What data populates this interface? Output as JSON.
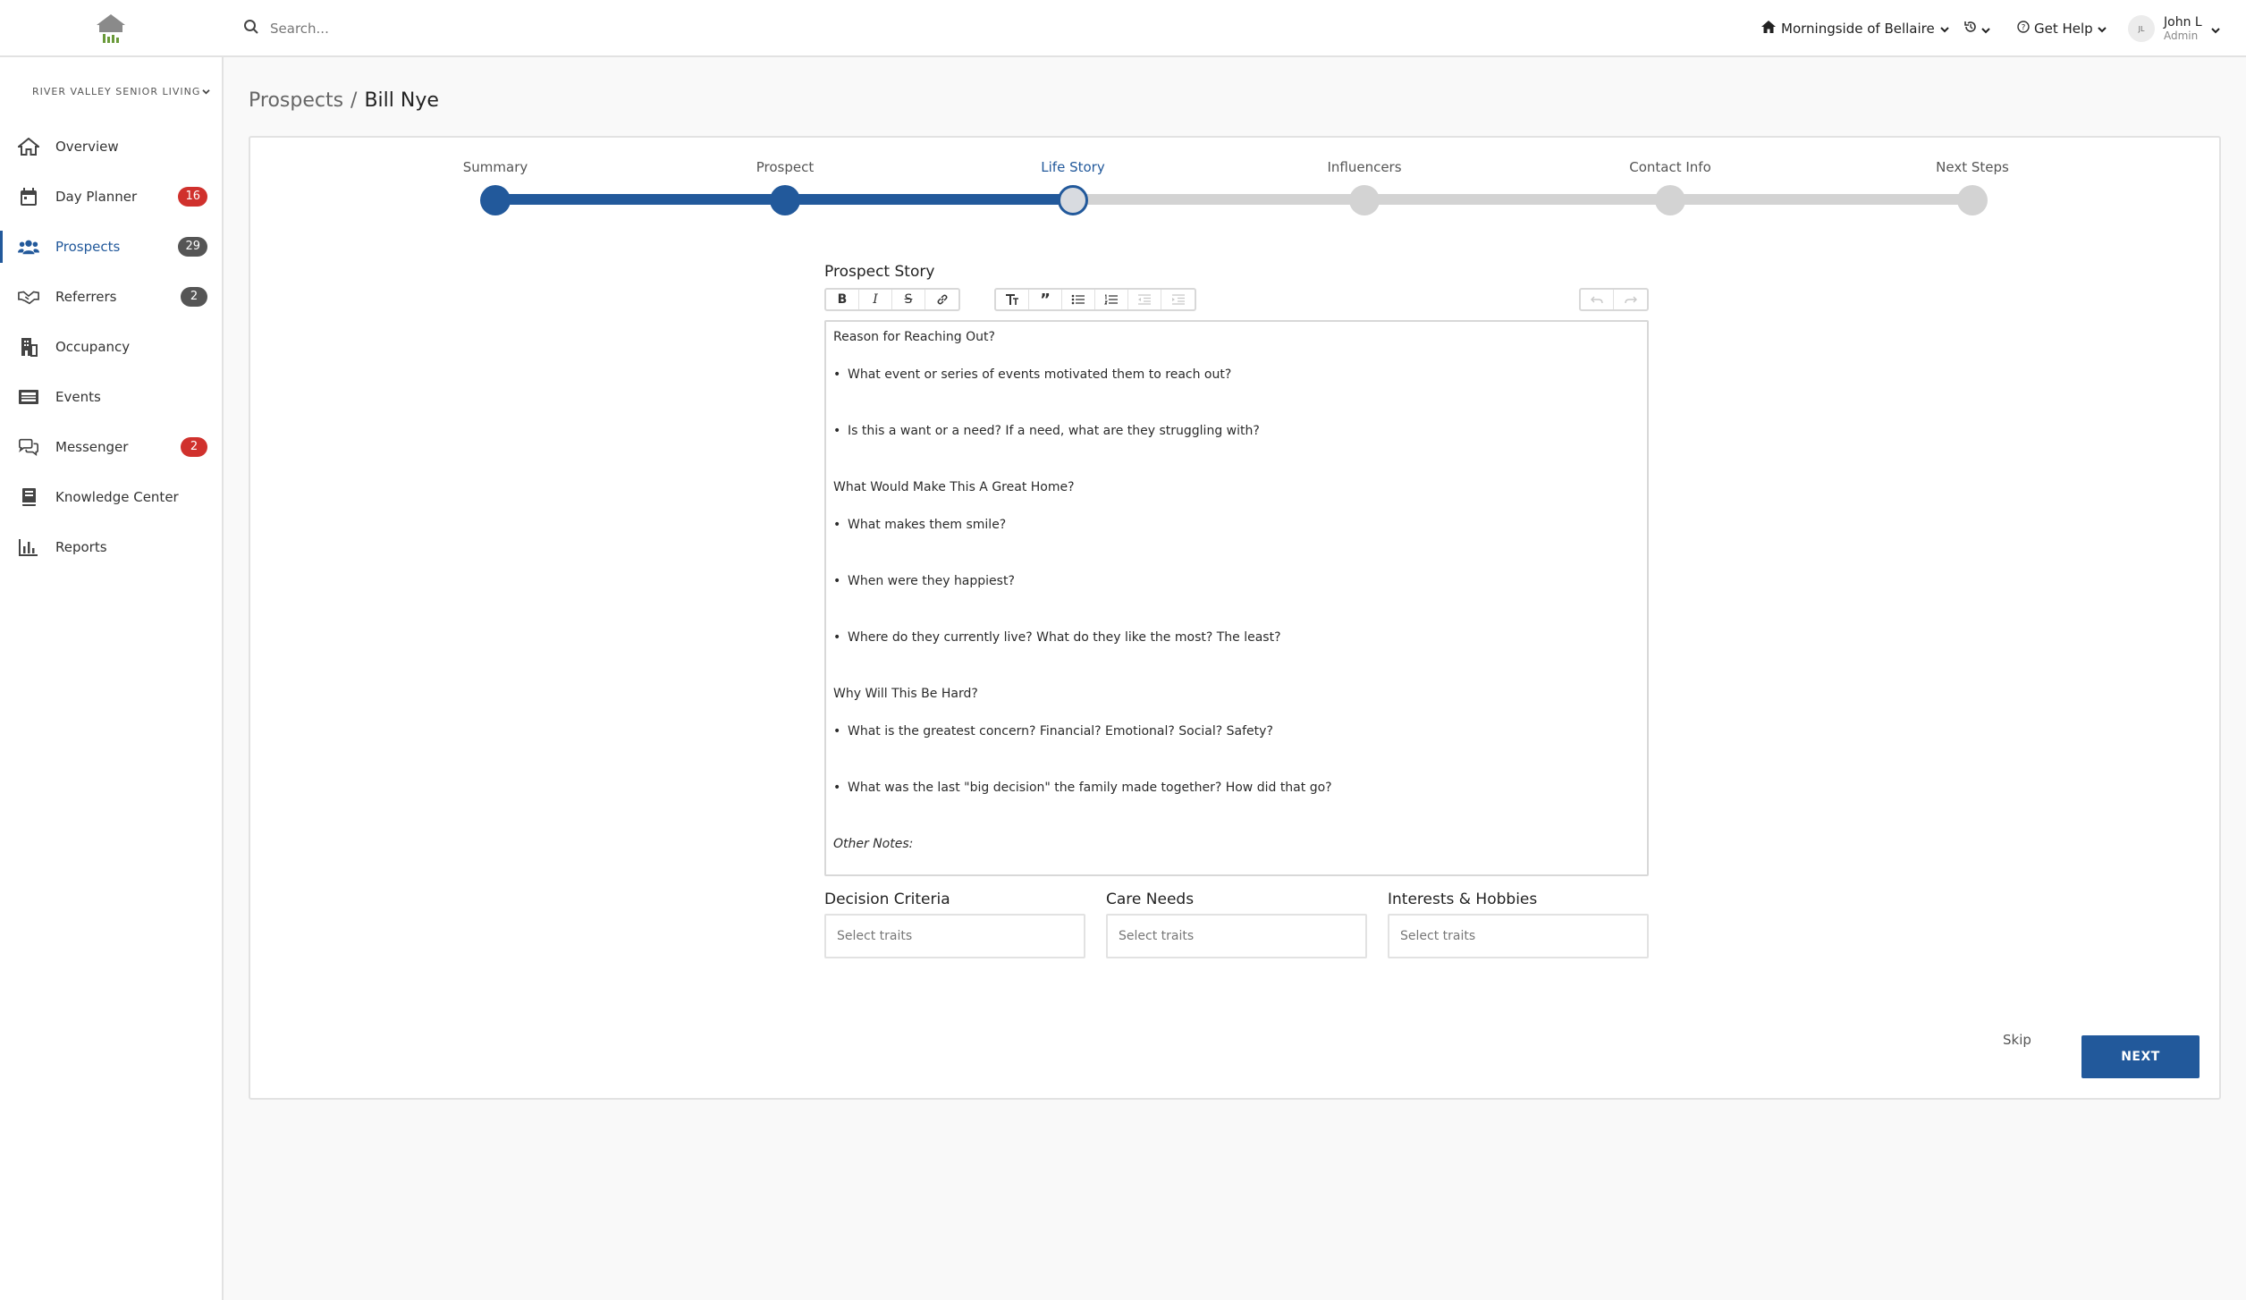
{
  "header": {
    "search_placeholder": "Search...",
    "community": "Morningside of Bellaire",
    "help": "Get Help",
    "user": {
      "initials": "JL",
      "name": "John L",
      "role": "Admin"
    }
  },
  "sidebar": {
    "org": "RIVER VALLEY SENIOR LIVING",
    "items": [
      {
        "label": "Overview",
        "icon": "home-icon"
      },
      {
        "label": "Day Planner",
        "icon": "calendar-icon",
        "badge": "16",
        "badge_color": "#d0312d"
      },
      {
        "label": "Prospects",
        "icon": "people-icon",
        "badge": "29",
        "badge_color": "#555555",
        "active": true
      },
      {
        "label": "Referrers",
        "icon": "handshake-icon",
        "badge": "2",
        "badge_color": "#555555"
      },
      {
        "label": "Occupancy",
        "icon": "building-icon"
      },
      {
        "label": "Events",
        "icon": "events-icon"
      },
      {
        "label": "Messenger",
        "icon": "chat-icon",
        "badge": "2",
        "badge_color": "#d0312d"
      },
      {
        "label": "Knowledge Center",
        "icon": "book-icon"
      },
      {
        "label": "Reports",
        "icon": "chart-icon"
      }
    ]
  },
  "breadcrumb": {
    "root": "Prospects",
    "separator": "/",
    "current": "Bill Nye"
  },
  "stepper": {
    "steps": [
      "Summary",
      "Prospect",
      "Life Story",
      "Influencers",
      "Contact Info",
      "Next Steps"
    ],
    "current_index": 2
  },
  "editor": {
    "title": "Prospect Story",
    "content": {
      "h1": "Reason for Reaching Out?",
      "b1": "What event or series of events motivated them to reach out?",
      "b2": "Is this a want or a need?  If a need, what are they struggling with?",
      "h2": "What Would Make This A Great Home?",
      "b3": "What makes them smile?",
      "b4": "When were they happiest?",
      "b5": "Where do they currently live?  What do they like the most?  The least?",
      "h3": "Why Will This Be Hard?",
      "b6": "What is the greatest concern?  Financial?  Emotional?  Social?  Safety?",
      "b7": "What was the last \"big decision\" the family made together?  How did that go?",
      "notes": "Other Notes:"
    }
  },
  "traits": {
    "decision": {
      "label": "Decision Criteria",
      "placeholder": "Select traits"
    },
    "care": {
      "label": "Care Needs",
      "placeholder": "Select traits"
    },
    "interests": {
      "label": "Interests & Hobbies",
      "placeholder": "Select traits"
    }
  },
  "actions": {
    "skip": "Skip",
    "next": "NEXT"
  },
  "colors": {
    "accent": "#22599b",
    "badge_red": "#d0312d",
    "badge_gray": "#555555"
  }
}
